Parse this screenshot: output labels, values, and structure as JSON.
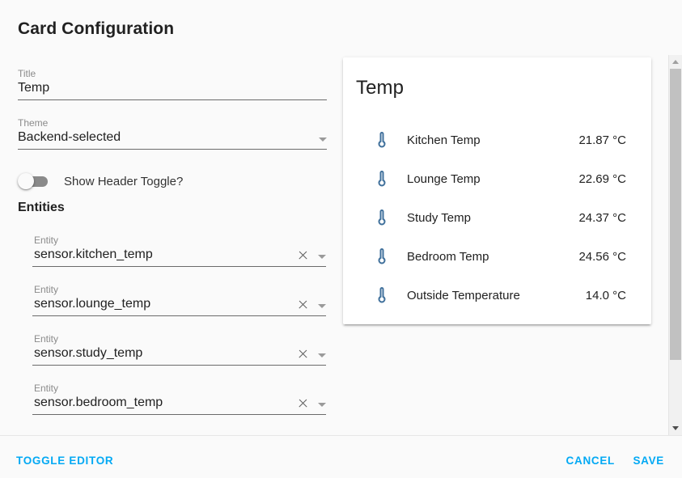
{
  "dialog": {
    "title": "Card Configuration"
  },
  "form": {
    "title_field": {
      "label": "Title",
      "value": "Temp"
    },
    "theme_field": {
      "label": "Theme",
      "value": "Backend-selected",
      "caret_icon": "chevron-down-icon"
    },
    "header_toggle": {
      "label": "Show Header Toggle?",
      "checked": false
    },
    "entities_heading": "Entities",
    "entities": [
      {
        "label": "Entity",
        "value": "sensor.kitchen_temp",
        "clear_icon": "close-icon",
        "caret_icon": "chevron-down-icon"
      },
      {
        "label": "Entity",
        "value": "sensor.lounge_temp",
        "clear_icon": "close-icon",
        "caret_icon": "chevron-down-icon"
      },
      {
        "label": "Entity",
        "value": "sensor.study_temp",
        "clear_icon": "close-icon",
        "caret_icon": "chevron-down-icon"
      },
      {
        "label": "Entity",
        "value": "sensor.bedroom_temp",
        "clear_icon": "close-icon",
        "caret_icon": "chevron-down-icon"
      }
    ]
  },
  "preview": {
    "card_title": "Temp",
    "rows": [
      {
        "icon": "thermometer-icon",
        "name": "Kitchen Temp",
        "value": "21.87 °C"
      },
      {
        "icon": "thermometer-icon",
        "name": "Lounge Temp",
        "value": "22.69 °C"
      },
      {
        "icon": "thermometer-icon",
        "name": "Study Temp",
        "value": "24.37 °C"
      },
      {
        "icon": "thermometer-icon",
        "name": "Bedroom Temp",
        "value": "24.56 °C"
      },
      {
        "icon": "thermometer-icon",
        "name": "Outside Temperature",
        "value": "14.0 °C"
      }
    ]
  },
  "scrollbar": {
    "up_icon": "scroll-up-arrow-icon",
    "down_icon": "scroll-down-arrow-icon"
  },
  "footer": {
    "toggle_editor_label": "TOGGLE EDITOR",
    "cancel_label": "CANCEL",
    "save_label": "SAVE"
  },
  "colors": {
    "accent": "#03a9f4",
    "icon_blue": "#41719c",
    "page_bg": "#fafafa",
    "card_bg": "#ffffff"
  }
}
